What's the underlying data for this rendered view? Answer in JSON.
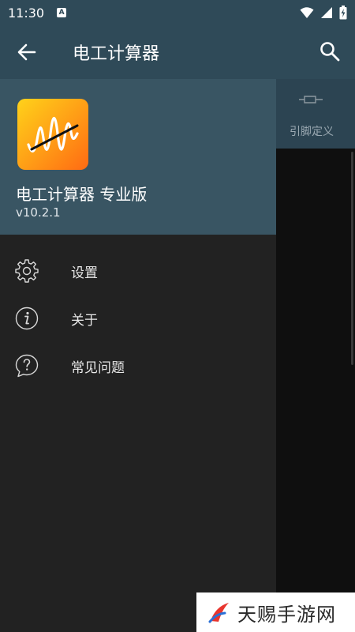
{
  "status_bar": {
    "time": "11:30",
    "a_icon_letter": "A"
  },
  "toolbar": {
    "title": "电工计算器",
    "back_icon": "arrow-left-icon",
    "search_icon": "search-icon"
  },
  "background": {
    "tab_label": "引脚定义",
    "tab_icon": "connector-icon"
  },
  "drawer": {
    "app_name": "电工计算器 专业版",
    "version": "v10.2.1",
    "items": [
      {
        "label": "设置",
        "icon": "gear-icon"
      },
      {
        "label": "关于",
        "icon": "info-icon"
      },
      {
        "label": "常见问题",
        "icon": "help-icon"
      }
    ]
  },
  "watermark": {
    "text": "天赐手游网"
  },
  "colors": {
    "header": "#2f4a58",
    "drawer_header": "#395563",
    "drawer_bg": "#222222",
    "accent": "#ff9b16"
  }
}
